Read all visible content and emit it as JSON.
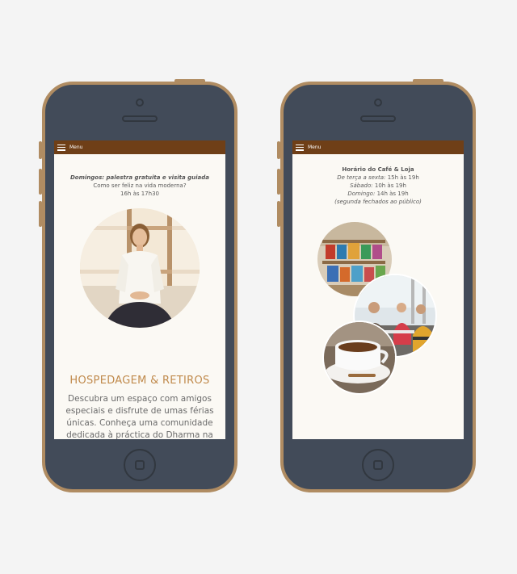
{
  "left": {
    "menu_label": "Menu",
    "intro_line1": "Domingos: palestra gratuita e visita guiada",
    "intro_line2": "Como ser feliz na vida moderna?",
    "intro_line3": "16h às 17h30",
    "heading": "HOSPEDAGEM & RETIROS",
    "paragraph": "Descubra um espaço com amigos especiais e disfrute de umas férias únicas. Conheça uma comunidade dedicada à práctica do Dharma na"
  },
  "right": {
    "menu_label": "Menu",
    "title": "Horário do Café & Loja",
    "hours_label1": "De terça a sexta:",
    "hours_value1": "15h às 19h",
    "hours_label2": "Sábado:",
    "hours_value2": "10h às 19h",
    "hours_label3": "Domingo:",
    "hours_value3": "14h às 19h",
    "note": "(segunda fechados ao público)"
  },
  "colors": {
    "background": "#f4f4f4",
    "phone_body": "#424b59",
    "phone_frame": "#b08c62",
    "menu_bar": "#6f3f17",
    "heading_accent": "#c08a4c"
  },
  "icons": [
    "hamburger-icon",
    "camera-icon",
    "speaker-icon",
    "home-button-icon"
  ]
}
